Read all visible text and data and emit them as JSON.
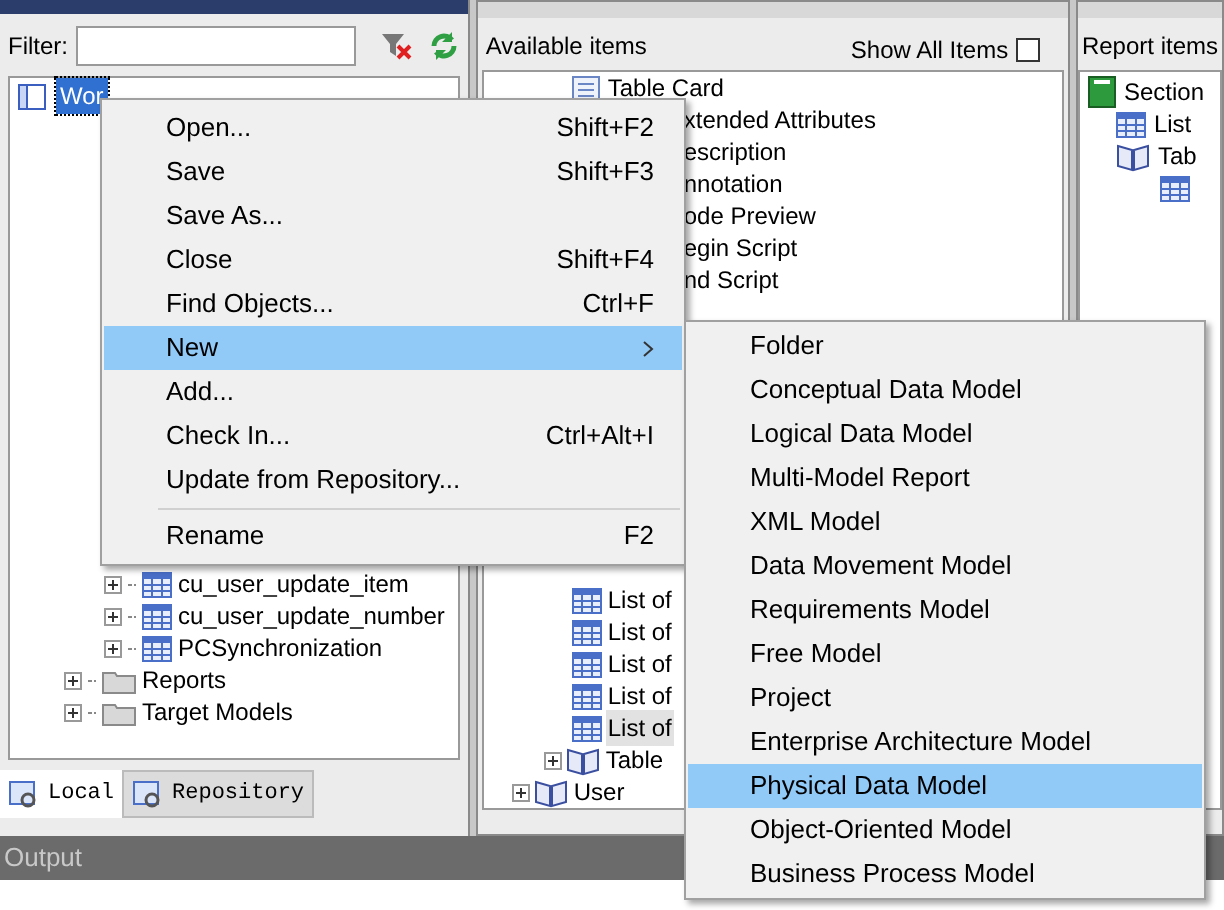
{
  "object_browser": {
    "filter": {
      "label": "Filter:"
    },
    "tree_top": [
      {
        "label": "Wor",
        "selected": true
      }
    ],
    "tree_bottom": [
      {
        "label": "cu_user_update_item",
        "kind": "table"
      },
      {
        "label": "cu_user_update_number",
        "kind": "table"
      },
      {
        "label": "PCSynchronization",
        "kind": "table"
      },
      {
        "label": "Reports",
        "kind": "folder"
      },
      {
        "label": "Target Models",
        "kind": "folder"
      }
    ],
    "tabs": [
      {
        "label": "Local",
        "selected": true
      },
      {
        "label": "Repository",
        "selected": false
      }
    ]
  },
  "report_editor": {
    "available_items": {
      "title": "Available items",
      "show_all": {
        "label": "Show All Items",
        "checked": false
      },
      "items_top": [
        {
          "label": "Table Card",
          "kind": "card"
        },
        {
          "label": "xtended Attributes",
          "kind": "text"
        },
        {
          "label": "escription",
          "kind": "text"
        },
        {
          "label": "nnotation",
          "kind": "text"
        },
        {
          "label": "ode Preview",
          "kind": "text"
        },
        {
          "label": "egin Script",
          "kind": "text"
        },
        {
          "label": "nd Script",
          "kind": "text"
        }
      ],
      "items_bottom": [
        {
          "label": "List of",
          "kind": "list",
          "selected": false
        },
        {
          "label": "List of",
          "kind": "list",
          "selected": false
        },
        {
          "label": "List of",
          "kind": "list",
          "selected": false
        },
        {
          "label": "List of",
          "kind": "list",
          "selected": false
        },
        {
          "label": "List of",
          "kind": "list",
          "selected": true
        },
        {
          "label": "Table",
          "kind": "book",
          "selected": false
        },
        {
          "label": "User",
          "kind": "root",
          "selected": false
        }
      ]
    },
    "report_items": {
      "title": "Report items",
      "items": [
        {
          "label": "Section",
          "kind": "section"
        },
        {
          "label": "List",
          "kind": "list"
        },
        {
          "label": "Tab",
          "kind": "book"
        },
        {
          "kind": "grid"
        }
      ]
    }
  },
  "output": {
    "title": "Output"
  },
  "context_menu": {
    "items": [
      {
        "kind": "item",
        "label": "Open...",
        "shortcut": "Shift+F2",
        "selected": false,
        "submenu": false
      },
      {
        "kind": "item",
        "label": "Save",
        "shortcut": "Shift+F3",
        "selected": false,
        "submenu": false
      },
      {
        "kind": "item",
        "label": "Save As...",
        "selected": false,
        "submenu": false
      },
      {
        "kind": "item",
        "label": "Close",
        "shortcut": "Shift+F4",
        "selected": false,
        "submenu": false
      },
      {
        "kind": "item",
        "label": "Find Objects...",
        "shortcut": "Ctrl+F",
        "selected": false,
        "submenu": false
      },
      {
        "kind": "item",
        "label": "New",
        "selected": true,
        "submenu": true
      },
      {
        "kind": "item",
        "label": "Add...",
        "selected": false,
        "submenu": false
      },
      {
        "kind": "item",
        "label": "Check In...",
        "shortcut": "Ctrl+Alt+I",
        "selected": false,
        "submenu": false
      },
      {
        "kind": "item",
        "label": "Update from Repository...",
        "selected": false,
        "submenu": false
      },
      {
        "kind": "separator"
      },
      {
        "kind": "item",
        "label": "Rename",
        "shortcut": "F2",
        "selected": false,
        "submenu": false
      }
    ]
  },
  "submenu": {
    "items": [
      {
        "label": "Folder",
        "selected": false
      },
      {
        "label": "Conceptual Data Model",
        "selected": false
      },
      {
        "label": "Logical Data Model",
        "selected": false
      },
      {
        "label": "Multi-Model Report",
        "selected": false
      },
      {
        "label": "XML Model",
        "selected": false
      },
      {
        "label": "Data Movement Model",
        "selected": false
      },
      {
        "label": "Requirements Model",
        "selected": false
      },
      {
        "label": "Free Model",
        "selected": false
      },
      {
        "label": "Project",
        "selected": false
      },
      {
        "label": "Enterprise Architecture Model",
        "selected": false
      },
      {
        "label": "Physical Data Model",
        "selected": true
      },
      {
        "label": "Object-Oriented Model",
        "selected": false
      },
      {
        "label": "Business Process Model",
        "selected": false
      }
    ]
  }
}
